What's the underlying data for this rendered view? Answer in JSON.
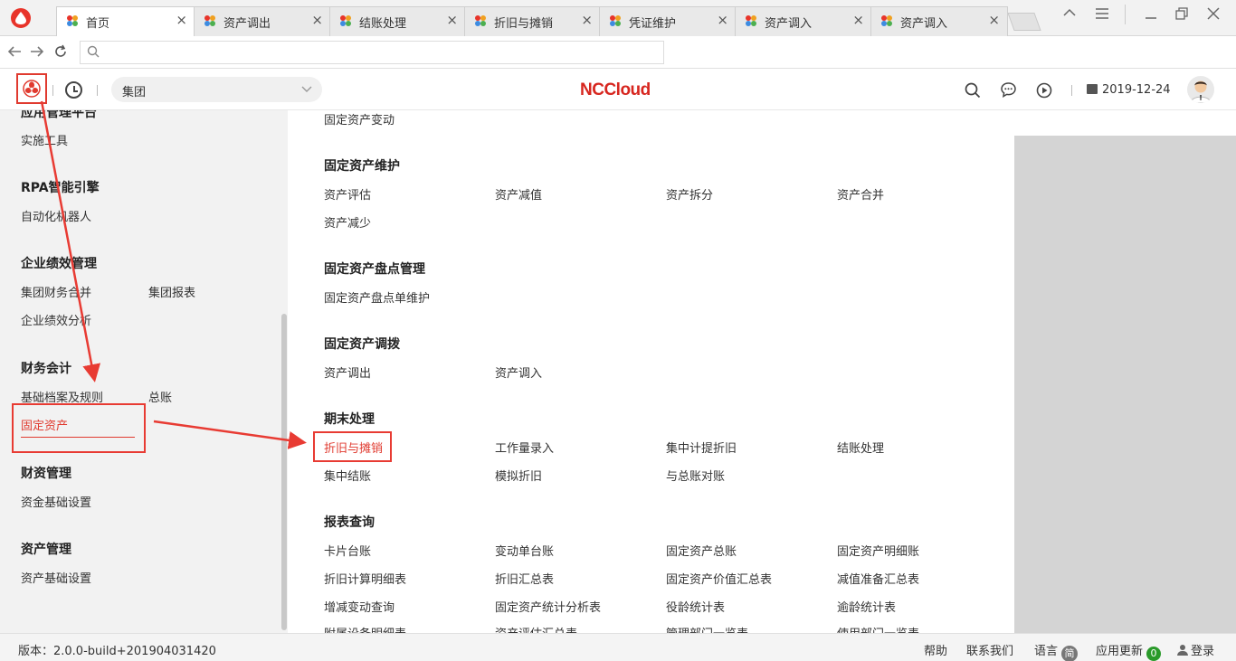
{
  "tabs": [
    {
      "label": "首页",
      "active": true
    },
    {
      "label": "资产调出"
    },
    {
      "label": "结账处理"
    },
    {
      "label": "折旧与摊销"
    },
    {
      "label": "凭证维护"
    },
    {
      "label": "资产调入"
    },
    {
      "label": "资产调入"
    }
  ],
  "tab_close_glyph": "×",
  "header": {
    "org_select_value": "集团",
    "brand": "NCCloud",
    "date": "2019-12-24"
  },
  "left_panel": {
    "top_partial_heading": "应用管理平台",
    "sections": [
      {
        "heading": "",
        "items": [
          "实施工具"
        ]
      },
      {
        "heading": "RPA智能引擎",
        "items": [
          "自动化机器人"
        ]
      },
      {
        "heading": "企业绩效管理",
        "items": [
          "集团财务合并",
          "集团报表",
          "企业绩效分析"
        ]
      },
      {
        "heading": "财务会计",
        "items": [
          "基础档案及规则",
          "总账",
          "固定资产"
        ]
      },
      {
        "heading": "财资管理",
        "items": [
          "资金基础设置"
        ]
      },
      {
        "heading": "资产管理",
        "items": [
          "资产基础设置"
        ]
      }
    ],
    "selected_item": "固定资产"
  },
  "menu": {
    "top_item": "固定资产变动",
    "groups": [
      {
        "heading": "固定资产维护",
        "items": [
          "资产评估",
          "资产减值",
          "资产拆分",
          "资产合并",
          "资产减少"
        ]
      },
      {
        "heading": "固定资产盘点管理",
        "items": [
          "固定资产盘点单维护"
        ]
      },
      {
        "heading": "固定资产调拨",
        "items": [
          "资产调出",
          "资产调入"
        ]
      },
      {
        "heading": "期末处理",
        "items": [
          "折旧与摊销",
          "工作量录入",
          "集中计提折旧",
          "结账处理",
          "集中结账",
          "模拟折旧",
          "与总账对账"
        ]
      },
      {
        "heading": "报表查询",
        "items": [
          "卡片台账",
          "变动单台账",
          "固定资产总账",
          "固定资产明细账",
          "折旧计算明细表",
          "折旧汇总表",
          "固定资产价值汇总表",
          "减值准备汇总表",
          "增减变动查询",
          "固定资产统计分析表",
          "役龄统计表",
          "逾龄统计表",
          "附属设备明细表",
          "资产评估汇总表",
          "管理部门一览表",
          "使用部门一览表"
        ]
      }
    ],
    "selected_item": "折旧与摊销"
  },
  "footer": {
    "version": "版本：2.0.0-build+201904031420",
    "help": "帮助",
    "contact": "联系我们",
    "language": "语言",
    "language_badge": "简",
    "app_update": "应用更新",
    "update_count": "0",
    "login": "登录"
  },
  "colors": {
    "accent_red": "#e03a2f",
    "annotation_red": "#e83b33",
    "panel_gray": "#f2f2f2",
    "update_green": "#2a9a2a"
  },
  "icons": {
    "browser": "browser-logo-icon",
    "favicon": "app-favicon-icon",
    "back": "back-arrow-icon",
    "forward": "forward-arrow-icon",
    "reload": "reload-icon",
    "app_menu": "app-menu-flower-icon",
    "history": "clock-icon",
    "search": "search-icon",
    "message": "chat-bubble-icon",
    "play": "play-circle-icon",
    "calendar": "calendar-icon",
    "user": "user-icon"
  }
}
